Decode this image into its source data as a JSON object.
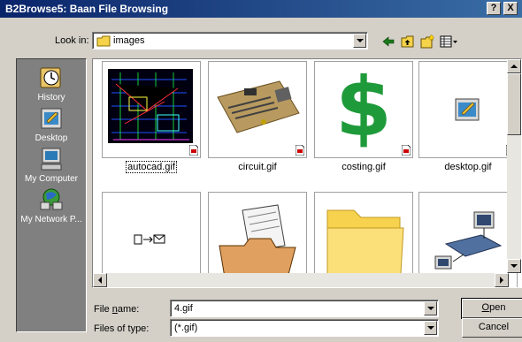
{
  "window": {
    "title": "B2Browse5: Baan File Browsing",
    "help": "?",
    "close": "X"
  },
  "lookin": {
    "label": "Look in:",
    "value": "images"
  },
  "places": [
    {
      "label": "History",
      "icon": "history-icon"
    },
    {
      "label": "Desktop",
      "icon": "desktop-icon"
    },
    {
      "label": "My Computer",
      "icon": "my-computer-icon"
    },
    {
      "label": "My Network P...",
      "icon": "network-places-icon"
    }
  ],
  "files": [
    {
      "name": "autocad.gif",
      "selected": true
    },
    {
      "name": "circuit.gif"
    },
    {
      "name": "costing.gif"
    },
    {
      "name": "desktop.gif"
    },
    {
      "name": ""
    },
    {
      "name": ""
    },
    {
      "name": ""
    },
    {
      "name": ""
    }
  ],
  "costing_glyph": "$",
  "filename": {
    "label_prefix": "File ",
    "label_u": "n",
    "label_suffix": "ame:",
    "value": "4.gif"
  },
  "filetype": {
    "label": "Files of type:",
    "value": "(*.gif)"
  },
  "buttons": {
    "open_u": "O",
    "open_rest": "pen",
    "cancel": "Cancel"
  }
}
